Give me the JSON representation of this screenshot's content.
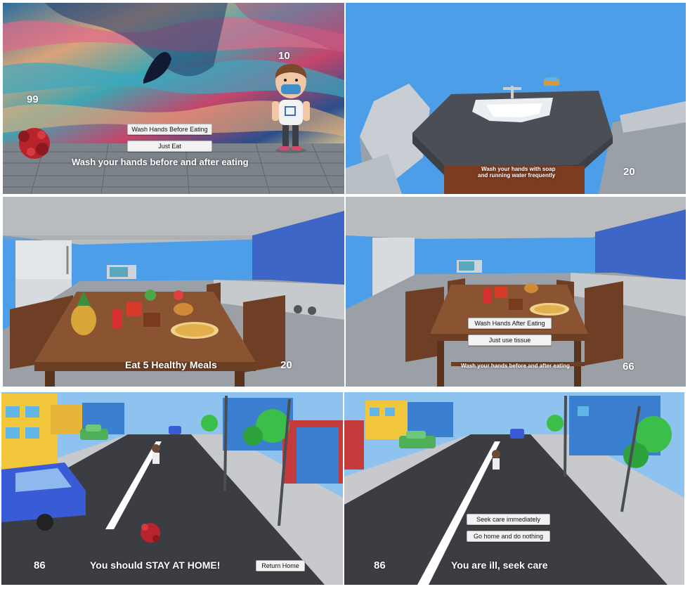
{
  "panels": {
    "p1": {
      "score_left": "99",
      "score_right": "10",
      "button_wash": "Wash Hands Before Eating",
      "button_eat": "Just Eat",
      "caption": "Wash your hands before and after eating"
    },
    "p2": {
      "caption_line1": "Wash your hands with soap",
      "caption_line2": "and running water frequently",
      "score": "20"
    },
    "p3": {
      "caption": "Eat 5 Healthy Meals",
      "score": "20"
    },
    "p4": {
      "button_wash": "Wash Hands After Eating",
      "button_tissue": "Just use tissue",
      "caption": "Wash your hands before and after eating",
      "score": "66"
    },
    "p5": {
      "score": "86",
      "caption": "You should STAY AT HOME!",
      "button_return": "Return Home"
    },
    "p6": {
      "button_seek": "Seek care immediately",
      "button_home": "Go home and do nothing",
      "score": "86",
      "caption": "You are ill, seek care"
    }
  },
  "colors": {
    "sky": "#4d9ee8",
    "floor_wood": "#7d838a",
    "table": "#8a5433",
    "road": "#3b3d42",
    "virus": "#b8232c"
  }
}
